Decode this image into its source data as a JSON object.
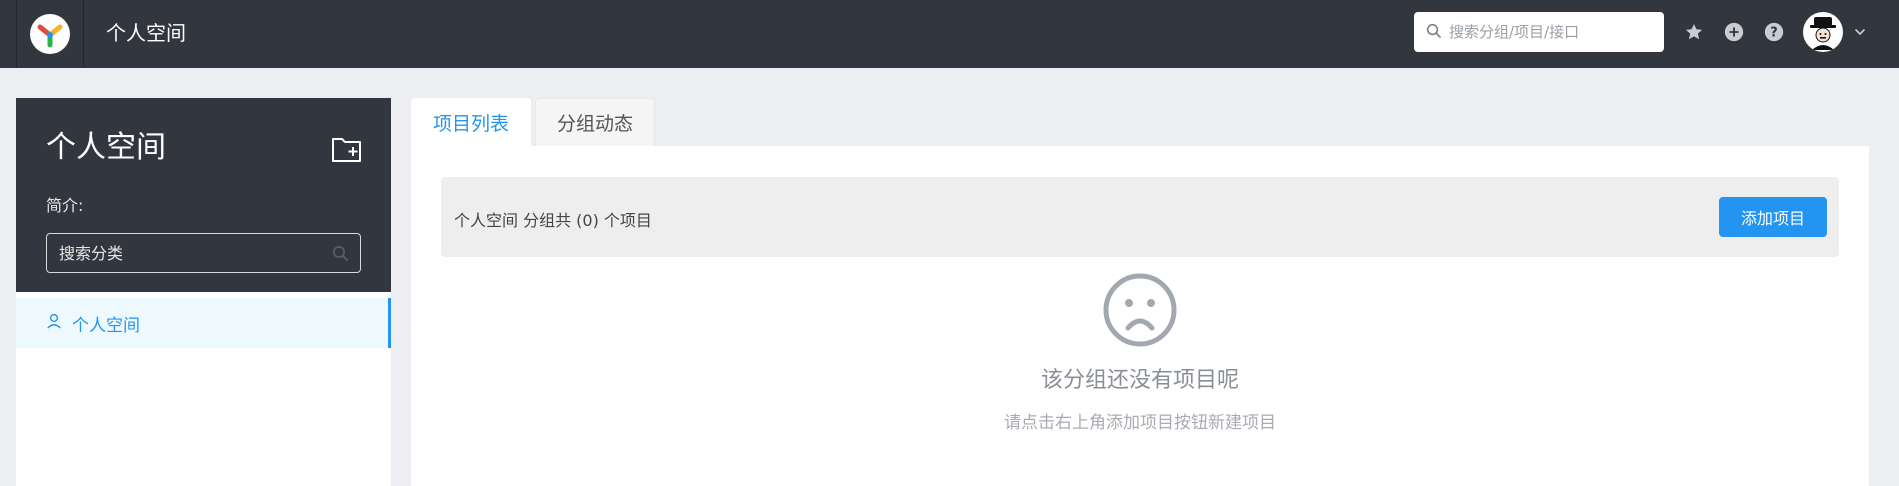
{
  "header": {
    "title": "个人空间",
    "search_placeholder": "搜索分组/项目/接口",
    "icons": [
      "star-icon",
      "add-circle-icon",
      "help-icon"
    ],
    "avatar": "user-avatar"
  },
  "sidebar": {
    "title": "个人空间",
    "intro_label": "简介:",
    "category_search_placeholder": "搜索分类",
    "groups": [
      {
        "label": "个人空间",
        "icon": "user-icon",
        "active": true
      }
    ]
  },
  "tabs": [
    {
      "label": "项目列表",
      "active": true
    },
    {
      "label": "分组动态",
      "active": false
    }
  ],
  "main": {
    "summary": "个人空间 分组共 (0) 个项目",
    "add_button": "添加项目",
    "empty_title": "该分组还没有项目呢",
    "empty_subtitle": "请点击右上角添加项目按钮新建项目"
  },
  "colors": {
    "header_bg": "#32363f",
    "accent": "#2395f1",
    "page_bg": "#eceef1"
  }
}
